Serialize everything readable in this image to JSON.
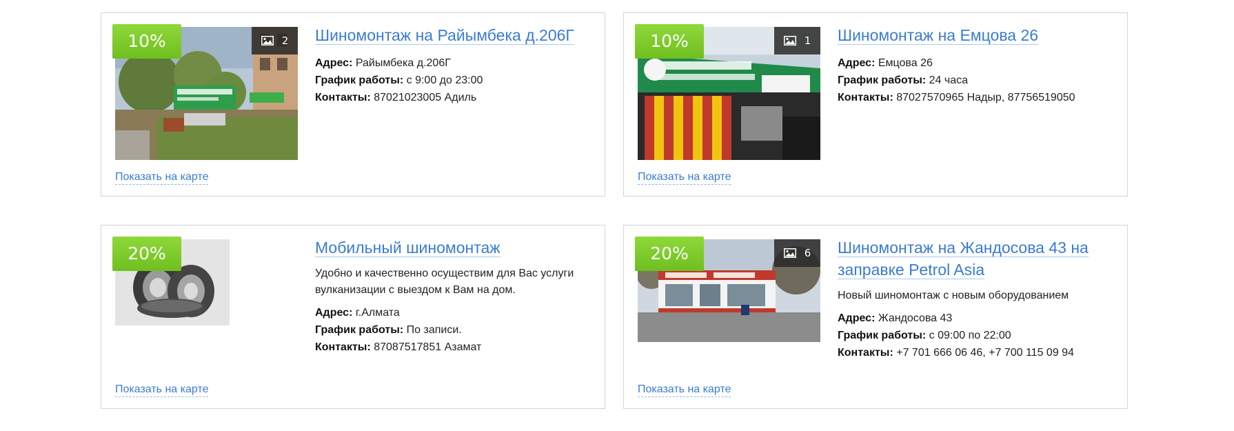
{
  "cards": [
    {
      "discount": "10%",
      "photo_count": "2",
      "photo_icon": "image-icon",
      "title": "Шиномонтаж на Райымбека д.206Г",
      "description": "",
      "address_label": "Адрес:",
      "address": "Райымбека д.206Г",
      "hours_label": "График работы:",
      "hours": "с 9:00 до 23:00",
      "contacts_label": "Контакты:",
      "contacts": "87021023005 Адиль",
      "map_link": "Показать на карте"
    },
    {
      "discount": "10%",
      "photo_count": "1",
      "photo_icon": "image-icon",
      "title": "Шиномонтаж на Емцова 26",
      "description": "",
      "address_label": "Адрес:",
      "address": "Емцова 26",
      "hours_label": "График работы:",
      "hours": "24 часа",
      "contacts_label": "Контакты:",
      "contacts": "87027570965 Надыр, 87756519050",
      "map_link": "Показать на карте"
    },
    {
      "discount": "20%",
      "photo_count": "",
      "photo_icon": "",
      "title": "Мобильный шиномонтаж",
      "description": "Удобно и качественно осуществим для Вас услуги вулканизации с выездом к Вам на дом.",
      "address_label": "Адрес:",
      "address": "г.Алмата",
      "hours_label": "График работы:",
      "hours": "По записи.",
      "contacts_label": "Контакты:",
      "contacts": "87087517851 Азамат",
      "map_link": "Показать на карте"
    },
    {
      "discount": "20%",
      "photo_count": "6",
      "photo_icon": "image-icon",
      "title": "Шиномонтаж на Жандосова 43 на заправке Petrol Asia",
      "description": "Новый шиномонтаж с новым оборудованием",
      "address_label": "Адрес:",
      "address": "Жандосова 43",
      "hours_label": "График работы:",
      "hours": "с 09:00 по 22:00",
      "contacts_label": "Контакты:",
      "contacts": "+7 701 666 06 46, +7 700 115 09 94",
      "map_link": "Показать на карте"
    }
  ],
  "colors": {
    "link": "#3a7bd5",
    "discount_green": "#7ac943",
    "border": "#d4d4d4"
  }
}
